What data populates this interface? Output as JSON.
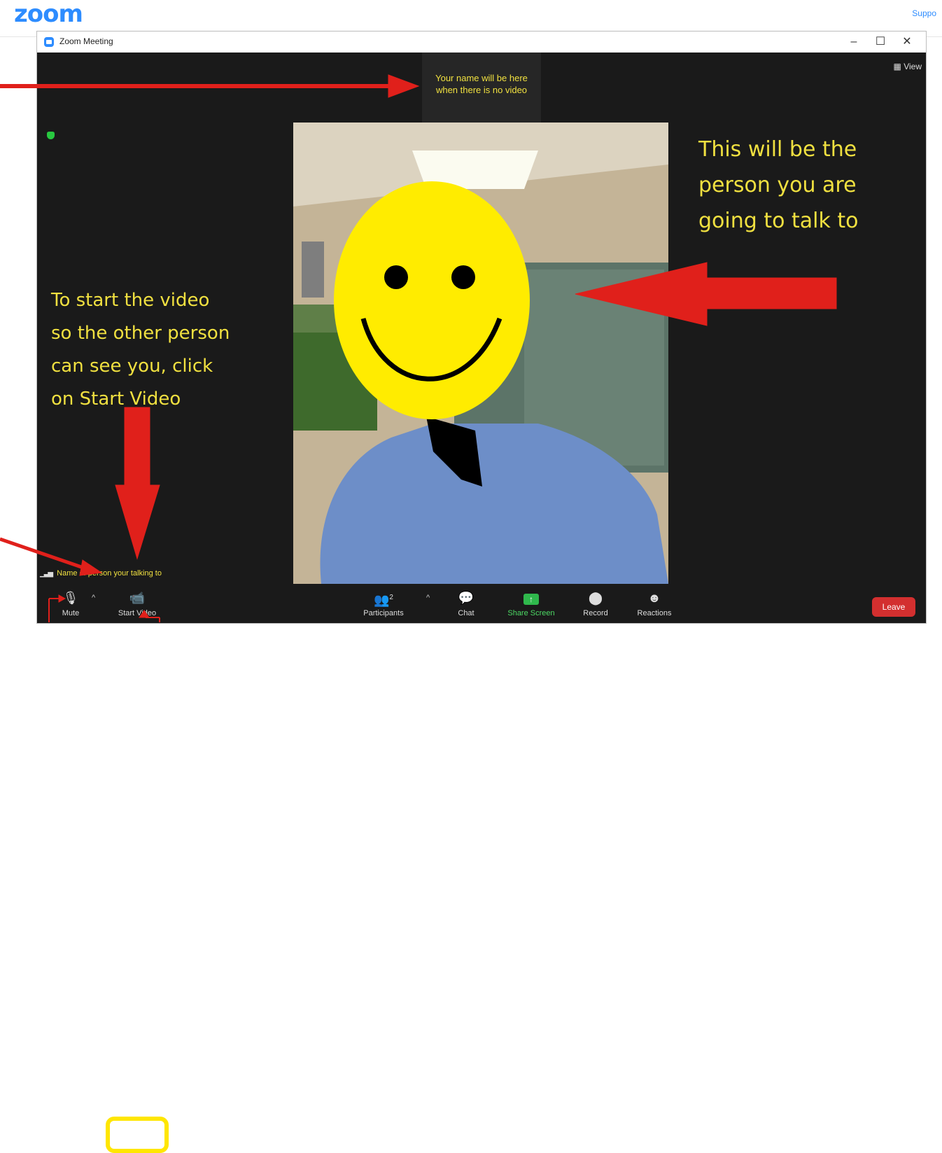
{
  "brand": {
    "logo_text": "zoom",
    "support_link": "Suppo"
  },
  "window": {
    "title": "Zoom Meeting",
    "controls": {
      "minimize": "–",
      "maximize": "☐",
      "close": "✕"
    }
  },
  "stage": {
    "view_button": "View",
    "name_placeholder": [
      "Your name will be here",
      "when there is no video"
    ]
  },
  "annotations": {
    "right_text": [
      "This will be the",
      "person you are",
      "going to talk to"
    ],
    "left_text": [
      "To start the video",
      "so the other person",
      "can see you, click",
      "on Start Video"
    ]
  },
  "name_label": "Name of person your talking to",
  "toolbar": {
    "mute": "Mute",
    "start_video": "Start Video",
    "participants": "Participants",
    "participants_count": "2",
    "chat": "Chat",
    "share_screen": "Share Screen",
    "record": "Record",
    "reactions": "Reactions",
    "leave": "Leave"
  },
  "colors": {
    "zoom_blue": "#2D8CFF",
    "annotation_yellow": "#F0E040",
    "arrow_red": "#E0201B",
    "leave_red": "#D32F2F",
    "share_green": "#2FB84C"
  }
}
